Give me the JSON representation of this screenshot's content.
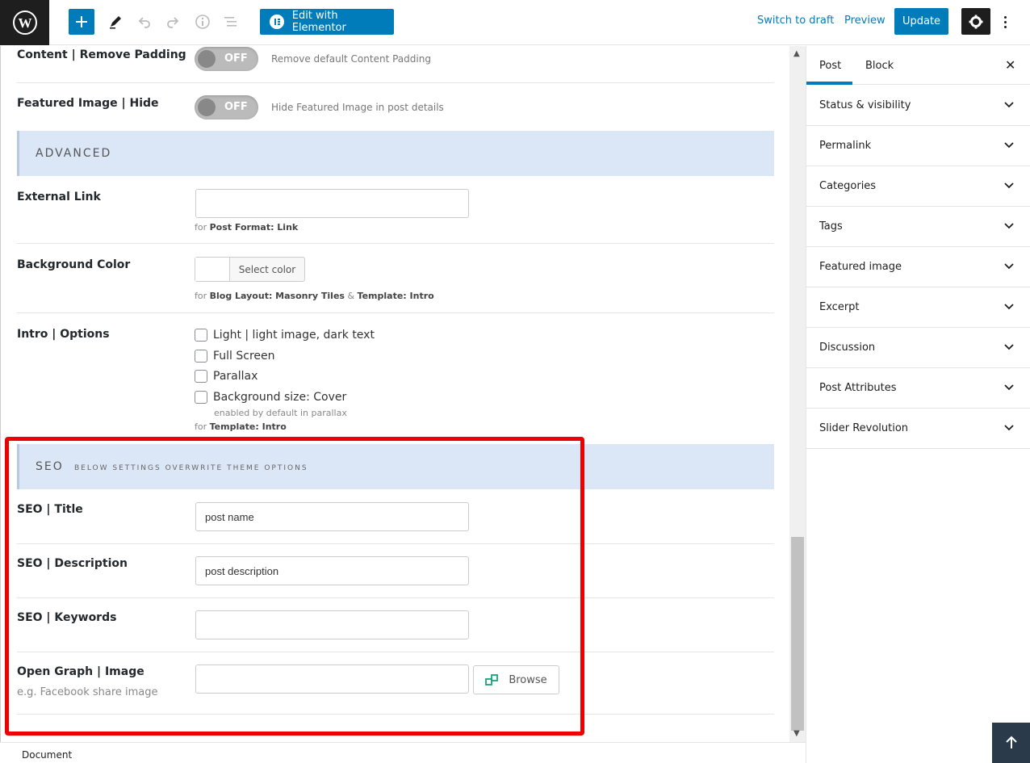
{
  "topbar": {
    "logo_icon": "wordpress-icon",
    "add_icon": "plus-icon",
    "tools_icon": "pencil-icon",
    "undo_icon": "undo-icon",
    "redo_icon": "redo-icon",
    "info_icon": "info-icon",
    "outline_icon": "list-outline-icon",
    "elementor_label": "Edit with Elementor",
    "switch_draft_label": "Switch to draft",
    "preview_label": "Preview",
    "update_label": "Update",
    "settings_icon": "gear-icon",
    "more_icon": "more-vertical-icon",
    "accent": "#007cba"
  },
  "content": {
    "remove_padding": {
      "label": "Content | Remove Padding",
      "toggle": "OFF",
      "desc": "Remove default Content Padding"
    },
    "featured_hide": {
      "label": "Featured Image | Hide",
      "toggle": "OFF",
      "desc": "Hide Featured Image in post details"
    },
    "advanced": {
      "title": "ADVANCED"
    },
    "external_link": {
      "label": "External Link",
      "value": "",
      "note_prefix": "for",
      "note_bold": "Post Format: Link"
    },
    "background_color": {
      "label": "Background Color",
      "button": "Select color",
      "note_prefix": "for",
      "note_bold1": "Blog Layout: Masonry Tiles",
      "note_amp": "&",
      "note_bold2": "Template: Intro"
    },
    "intro_options": {
      "label": "Intro | Options",
      "checkboxes": [
        "Light | light image, dark text",
        "Full Screen",
        "Parallax",
        "Background size: Cover"
      ],
      "cover_sub": "enabled by default in parallax",
      "note_prefix": "for",
      "note_bold": "Template: Intro"
    },
    "seo": {
      "title": "SEO",
      "subtitle": "BELOW SETTINGS OVERWRITE THEME OPTIONS",
      "title_label": "SEO | Title",
      "title_value": "post name",
      "desc_label": "SEO | Description",
      "desc_value": "post description",
      "keywords_label": "SEO | Keywords",
      "keywords_value": "",
      "og_label": "Open Graph | Image",
      "og_hint": "e.g. Facebook share image",
      "og_value": "",
      "browse_label": "Browse",
      "browse_icon": "browse-icon"
    },
    "highlight_color": "#ee0000"
  },
  "sidebar": {
    "tabs": [
      "Post",
      "Block"
    ],
    "close_icon": "close-icon",
    "panels": [
      "Status & visibility",
      "Permalink",
      "Categories",
      "Tags",
      "Featured image",
      "Excerpt",
      "Discussion",
      "Post Attributes",
      "Slider Revolution"
    ],
    "chevron_icon": "chevron-down-icon"
  },
  "footer": {
    "label": "Document",
    "scroll_top_icon": "arrow-up-icon"
  }
}
